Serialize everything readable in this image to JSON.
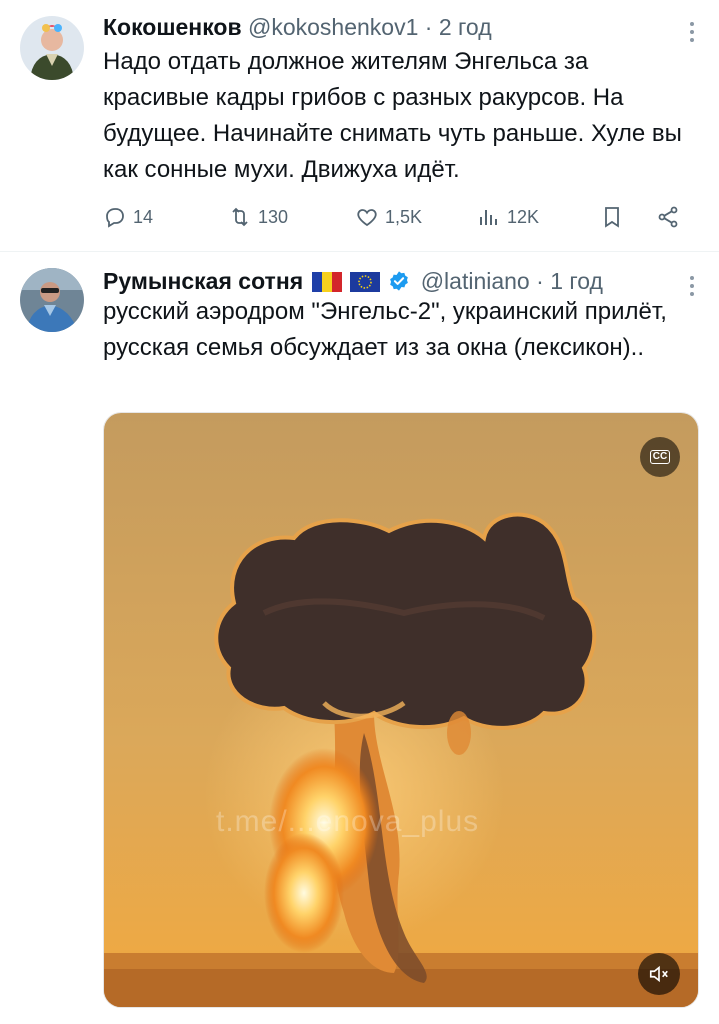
{
  "tweets": [
    {
      "name": "Кокошенков",
      "handle": "@kokoshenkov1",
      "separator": "·",
      "time": "2 год",
      "text": "Надо отдать должное жителям Энгельса за красивые кадры грибов с разных ракурсов. На будущее. Начинайте снимать чуть раньше. Хуле вы как сонные мухи. Движуха идёт.",
      "replies": "14",
      "reposts": "130",
      "likes": "1,5K",
      "views": "12K"
    },
    {
      "name": "Румынская сотня",
      "handle": "@latiniano",
      "separator": "·",
      "time": "1 год",
      "text": "русский аэродром \"Энгельс-2\", украинский прилёт, русская семья обсуждает из за окна (лексикон)..",
      "media": {
        "watermark": "t.me/...enova_plus",
        "cc_label": "CC"
      }
    }
  ],
  "colors": {
    "text": "#0f1419",
    "secondary": "#536471",
    "verified": "#1d9bf0",
    "divider": "#eff3f4"
  },
  "icons": [
    "more-icon",
    "reply-icon",
    "repost-icon",
    "like-icon",
    "views-icon",
    "bookmark-icon",
    "share-icon",
    "verified-icon",
    "cc-icon",
    "mute-icon"
  ]
}
